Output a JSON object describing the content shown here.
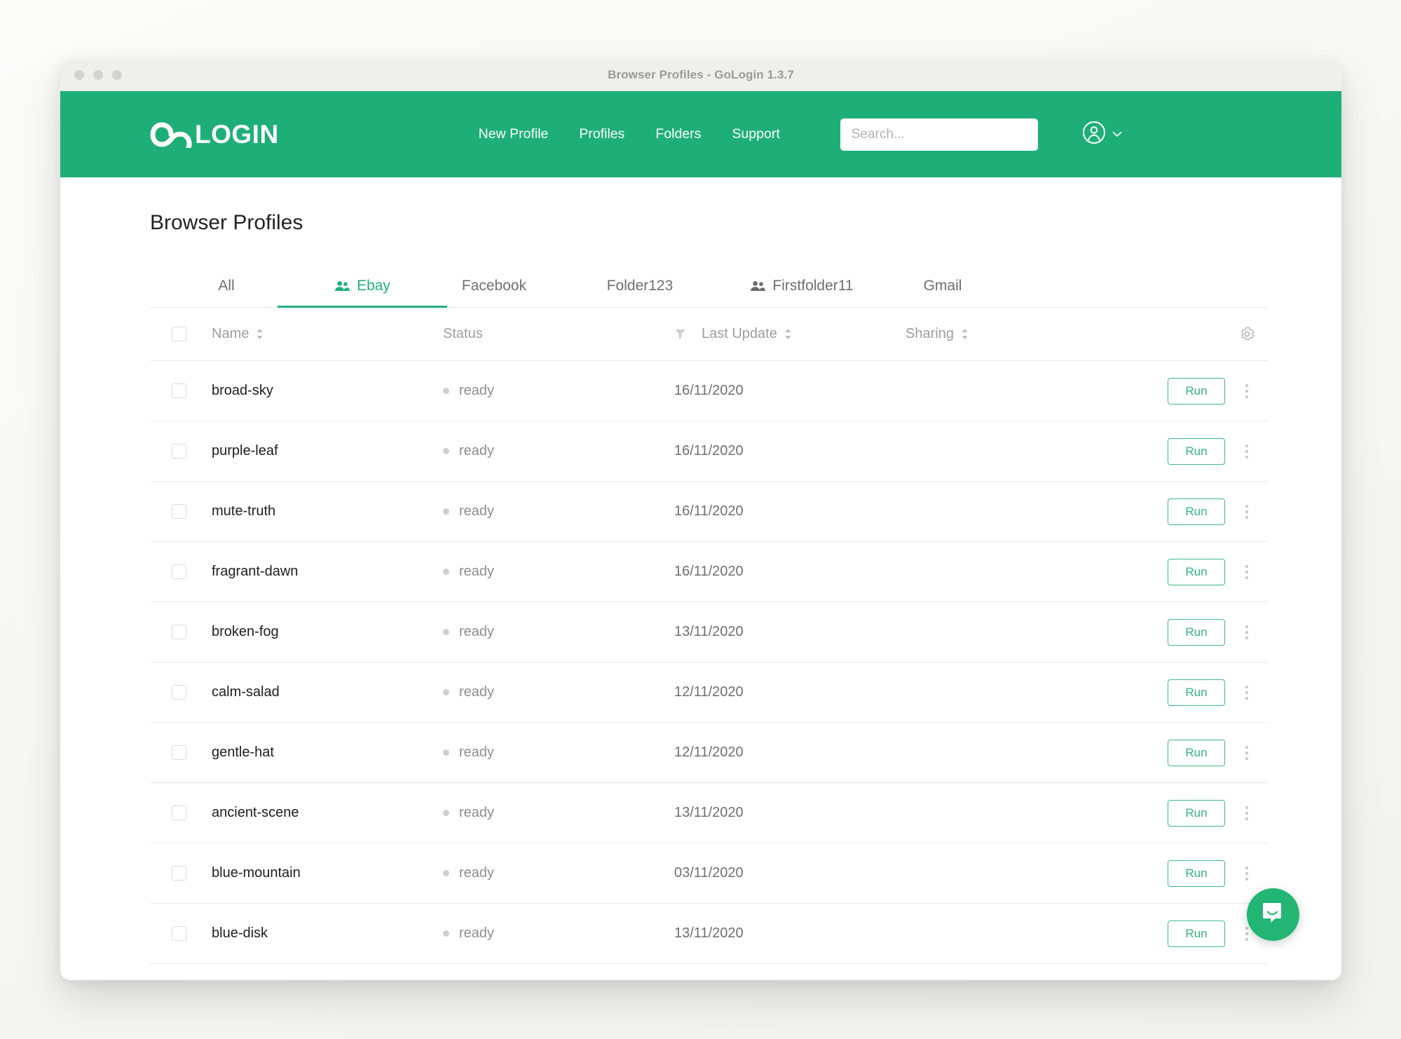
{
  "window": {
    "title": "Browser Profiles - GoLogin 1.3.7"
  },
  "header": {
    "brand_go": "GO",
    "brand_login": "LOGIN",
    "nav": [
      {
        "label": "New Profile",
        "name": "nav-new-profile"
      },
      {
        "label": "Profiles",
        "name": "nav-profiles"
      },
      {
        "label": "Folders",
        "name": "nav-folders"
      },
      {
        "label": "Support",
        "name": "nav-support"
      }
    ],
    "search": {
      "value": "",
      "placeholder": "Search..."
    },
    "user_icon": "user-circle-icon",
    "user_chevron": "chevron-down-icon",
    "bg_color": "#1eaf78"
  },
  "main": {
    "page_title": "Browser Profiles",
    "tabs": [
      {
        "label": "All",
        "icon": null,
        "active": false
      },
      {
        "label": "Ebay",
        "icon": "people-icon",
        "active": true
      },
      {
        "label": "Facebook",
        "icon": null,
        "active": false
      },
      {
        "label": "Folder123",
        "icon": null,
        "active": false
      },
      {
        "label": "Firstfolder11",
        "icon": "people-icon",
        "active": false
      },
      {
        "label": "Gmail",
        "icon": null,
        "active": false
      }
    ],
    "accent_color": "#21b07a"
  },
  "table": {
    "columns": {
      "name": "Name",
      "status": "Status",
      "last_update": "Last Update",
      "sharing": "Sharing"
    },
    "header_icons": {
      "select_all": "checkbox-icon",
      "filter": "filter-icon",
      "settings": "gear-icon",
      "sort": "sort-arrows-icon"
    },
    "row_action_label": "Run",
    "row_menu_icon": "kebab-menu-icon",
    "rows": [
      {
        "name": "broad-sky",
        "status": "ready",
        "last_update": "16/11/2020",
        "sharing": ""
      },
      {
        "name": "purple-leaf",
        "status": "ready",
        "last_update": "16/11/2020",
        "sharing": ""
      },
      {
        "name": "mute-truth",
        "status": "ready",
        "last_update": "16/11/2020",
        "sharing": ""
      },
      {
        "name": "fragrant-dawn",
        "status": "ready",
        "last_update": "16/11/2020",
        "sharing": ""
      },
      {
        "name": "broken-fog",
        "status": "ready",
        "last_update": "13/11/2020",
        "sharing": ""
      },
      {
        "name": "calm-salad",
        "status": "ready",
        "last_update": "12/11/2020",
        "sharing": ""
      },
      {
        "name": "gentle-hat",
        "status": "ready",
        "last_update": "12/11/2020",
        "sharing": ""
      },
      {
        "name": "ancient-scene",
        "status": "ready",
        "last_update": "13/11/2020",
        "sharing": ""
      },
      {
        "name": "blue-mountain",
        "status": "ready",
        "last_update": "03/11/2020",
        "sharing": ""
      },
      {
        "name": "blue-disk",
        "status": "ready",
        "last_update": "13/11/2020",
        "sharing": ""
      }
    ]
  },
  "chat": {
    "icon": "chat-bubble-icon",
    "color": "#22b573"
  }
}
